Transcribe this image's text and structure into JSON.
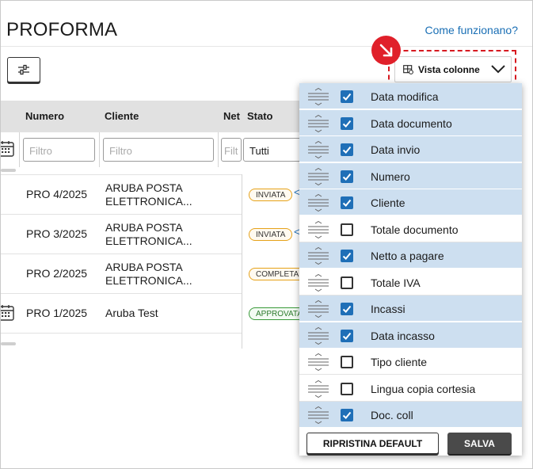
{
  "page": {
    "title": "PROFORMA",
    "help_link": "Come funzionano?"
  },
  "toolbar": {
    "view_columns_label": "Vista colonne"
  },
  "table": {
    "headers": {
      "numero": "Numero",
      "cliente": "Cliente",
      "netto": "Net",
      "stato": "Stato"
    },
    "filters": {
      "numero_placeholder": "Filtro",
      "cliente_placeholder": "Filtro",
      "netto_placeholder": "Filt",
      "stato_value": "Tutti"
    },
    "rows": [
      {
        "numero": "PRO 4/2025",
        "cliente_l1": "ARUBA POSTA",
        "cliente_l2": "ELETTRONICA...",
        "stato": "INVIATA"
      },
      {
        "numero": "PRO 3/2025",
        "cliente_l1": "ARUBA POSTA",
        "cliente_l2": "ELETTRONICA...",
        "stato": "INVIATA"
      },
      {
        "numero": "PRO 2/2025",
        "cliente_l1": "ARUBA POSTA",
        "cliente_l2": "ELETTRONICA...",
        "stato": "COMPLETA"
      },
      {
        "numero": "PRO 1/2025",
        "cliente_l1": "Aruba Test",
        "cliente_l2": "",
        "stato": "APPROVATA"
      }
    ]
  },
  "columns_panel": {
    "options": [
      {
        "label": "Data modifica",
        "checked": true
      },
      {
        "label": "Data documento",
        "checked": true
      },
      {
        "label": "Data invio",
        "checked": true
      },
      {
        "label": "Numero",
        "checked": true
      },
      {
        "label": "Cliente",
        "checked": true
      },
      {
        "label": "Totale documento",
        "checked": false
      },
      {
        "label": "Netto a pagare",
        "checked": true
      },
      {
        "label": "Totale IVA",
        "checked": false
      },
      {
        "label": "Incassi",
        "checked": true
      },
      {
        "label": "Data incasso",
        "checked": true
      },
      {
        "label": "Tipo cliente",
        "checked": false
      },
      {
        "label": "Lingua copia cortesia",
        "checked": false
      },
      {
        "label": "Doc. coll",
        "checked": true
      }
    ],
    "reset_label": "RIPRISTINA DEFAULT",
    "save_label": "SALVA"
  },
  "colors": {
    "accent": "#1f6fb7",
    "highlight": "#cddff0",
    "alert": "#e0202a",
    "link": "#1a6fb5"
  }
}
